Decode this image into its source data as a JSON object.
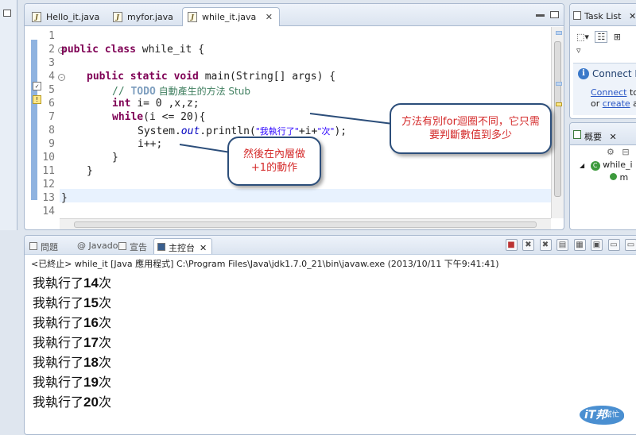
{
  "editor": {
    "tabs": [
      {
        "label": "Hello_it.java",
        "close": "✕"
      },
      {
        "label": "myfor.java",
        "close": "✕"
      },
      {
        "label": "while_it.java",
        "close": "✕",
        "active": true
      }
    ],
    "line_numbers": [
      "1",
      "2",
      "3",
      "4",
      "5",
      "6",
      "7",
      "8",
      "9",
      "10",
      "11",
      "12",
      "13",
      "14"
    ],
    "code": {
      "l2_kw": "public class ",
      "l2_rest": "while_it {",
      "l4_kw": "public static void ",
      "l4_rest": "main(String[] args) {",
      "l5_comment": "// ",
      "l5_todo": "TODO",
      "l5_text": " 自動產生的方法 Stub",
      "l6_kw": "int ",
      "l6_rest": "i= 0 ,x,z;",
      "l7_kw": "while",
      "l7_rest": "(i <= 20){",
      "l8_a": "System.",
      "l8_field": "out",
      "l8_b": ".println(",
      "l8_s1": "\"我執行了\"",
      "l8_c": "+i+",
      "l8_s2": "\"次\"",
      "l8_d": ");",
      "l9": "i++;",
      "l10": "}",
      "l11": "}",
      "l13": "}"
    }
  },
  "callouts": {
    "right": "方法有別for迴圈不同，它只需要判斷數值到多少",
    "left": "然後在內層做+1的動作"
  },
  "tasklist": {
    "title": "Task List",
    "close": "✕",
    "connect_title": "Connect M",
    "connect_link": "Connect",
    "connect_text": " to",
    "or_text": "or ",
    "create_link": "create",
    "create_rest": " a l"
  },
  "outline": {
    "title": "概要",
    "close": "✕",
    "class_item": "while_i",
    "method_item": "m"
  },
  "console": {
    "tabs": [
      {
        "label": "問題",
        "close": ""
      },
      {
        "label": "@ Javadoc",
        "close": ""
      },
      {
        "label": "宣告",
        "close": ""
      },
      {
        "label": "主控台",
        "close": "✕",
        "active": true
      }
    ],
    "terminated": "<已終止> while_it [Java 應用程式] C:\\Program Files\\Java\\jdk1.7.0_21\\bin\\javaw.exe (2013/10/11 下午9:41:41)",
    "output": [
      {
        "pre": "我執行了",
        "num": "14",
        "post": "次"
      },
      {
        "pre": "我執行了",
        "num": "15",
        "post": "次"
      },
      {
        "pre": "我執行了",
        "num": "16",
        "post": "次"
      },
      {
        "pre": "我執行了",
        "num": "17",
        "post": "次"
      },
      {
        "pre": "我執行了",
        "num": "18",
        "post": "次"
      },
      {
        "pre": "我執行了",
        "num": "19",
        "post": "次"
      },
      {
        "pre": "我執行了",
        "num": "20",
        "post": "次"
      }
    ]
  },
  "watermark": {
    "main": "iT邦",
    "sub": "幫忙"
  },
  "colors": {
    "keyword": "#7f0055",
    "comment": "#3f7f5f",
    "string": "#2a00ff",
    "callout_text": "#d42a2a",
    "callout_border": "#2c4e7a"
  }
}
